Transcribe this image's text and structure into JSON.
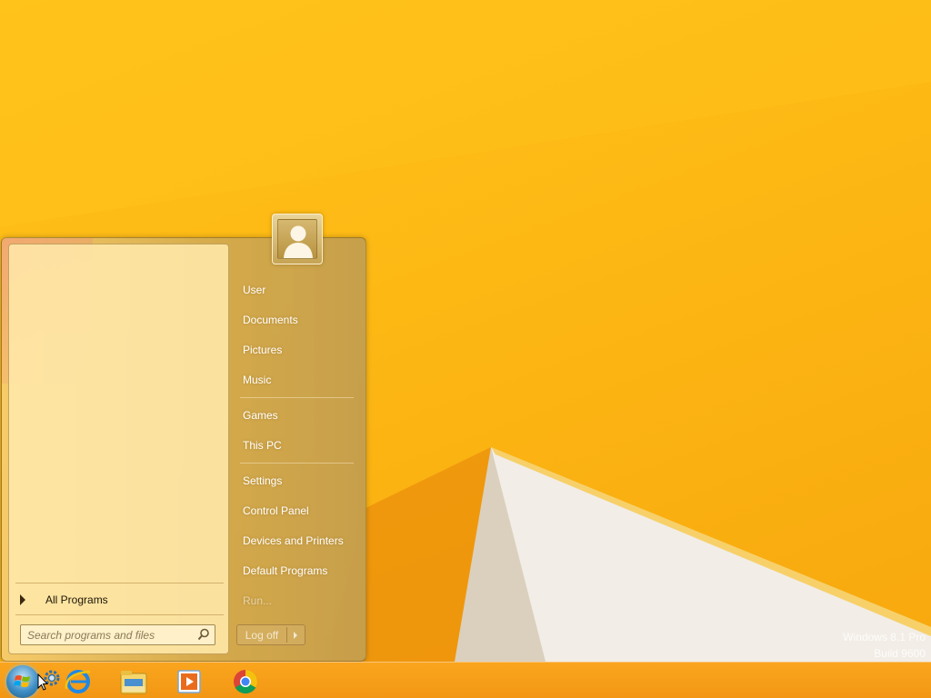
{
  "desktop": {
    "watermark_line1": "Windows 8.1 Pro",
    "watermark_line2": "Build 9600"
  },
  "start_menu": {
    "all_programs_label": "All Programs",
    "search": {
      "placeholder": "Search programs and files"
    },
    "right_items": [
      {
        "label": "User"
      },
      {
        "label": "Documents"
      },
      {
        "label": "Pictures"
      },
      {
        "label": "Music"
      },
      {
        "label": "Games"
      },
      {
        "label": "This PC"
      },
      {
        "label": "Settings"
      },
      {
        "label": "Control Panel"
      },
      {
        "label": "Devices and Printers"
      },
      {
        "label": "Default Programs"
      },
      {
        "label": "Run..."
      }
    ],
    "logoff_label": "Log off"
  },
  "taskbar": {
    "icons": [
      {
        "name": "start-orb-icon"
      },
      {
        "name": "internet-explorer-icon"
      },
      {
        "name": "file-explorer-icon"
      },
      {
        "name": "media-player-icon"
      },
      {
        "name": "chrome-icon"
      }
    ]
  },
  "colors": {
    "wallpaper": "#FBB117",
    "taskbar": "#F5A016",
    "menu_text": "#FFFFFF"
  }
}
